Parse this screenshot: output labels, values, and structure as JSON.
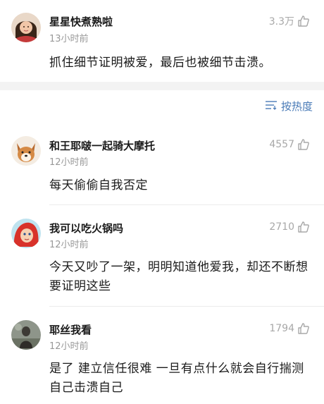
{
  "top_comment": {
    "username": "星星快煮熟啦",
    "time": "13小时前",
    "likes": "3.3万",
    "text": "抓住细节证明被爱，最后也被细节击溃。"
  },
  "sort": {
    "label": "按热度",
    "icon": "sort-lines-icon"
  },
  "comments": [
    {
      "username": "和王耶啵一起骑大摩托",
      "time": "12小时前",
      "likes": "4557",
      "text": "每天偷偷自我否定"
    },
    {
      "username": "我可以吃火锅吗",
      "time": "12小时前",
      "likes": "2710",
      "text": "今天又吵了一架，明明知道他爱我，却还不断想要证明这些"
    },
    {
      "username": "耶丝我看",
      "time": "12小时前",
      "likes": "1794",
      "text": "是了 建立信任很难 一旦有点什么就会自行揣测 自己击溃自己"
    }
  ],
  "colors": {
    "link_blue": "#4a7bb7",
    "meta_gray": "#999999",
    "like_gray": "#a8a8a8",
    "section_band": "#f3f3f3"
  }
}
